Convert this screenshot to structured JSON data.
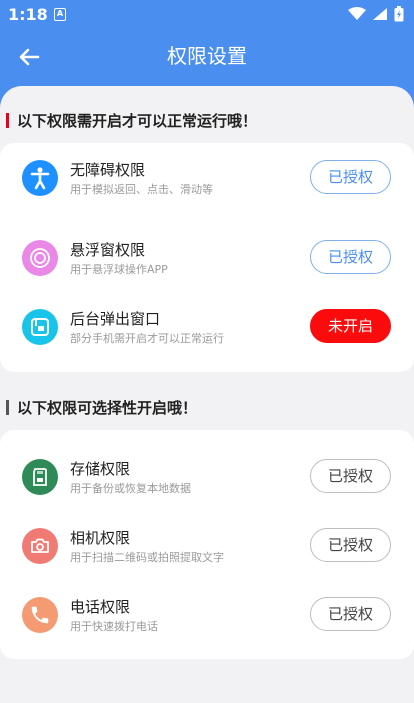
{
  "status_bar": {
    "time": "1:18",
    "sim_label": "A"
  },
  "header": {
    "title": "权限设置"
  },
  "sections": [
    {
      "title": "以下权限需开启才可以正常运行哦！",
      "bar_color": "#e8001c",
      "items": [
        {
          "name": "无障碍权限",
          "desc": "用于模拟返回、点击、滑动等",
          "button": "已授权",
          "icon": "accessibility-icon",
          "icon_color": "#1e90ff"
        },
        {
          "name": "悬浮窗权限",
          "desc": "用于悬浮球操作APP",
          "button": "已授权",
          "icon": "floating-window-icon",
          "icon_color": "#e988e6"
        },
        {
          "name": "后台弹出窗口",
          "desc": "部分手机需开启才可以正常运行",
          "button": "未开启",
          "icon": "popup-window-icon",
          "icon_color": "#18c4ea"
        }
      ]
    },
    {
      "title": "以下权限可选择性开启哦！",
      "bar_color": "#555555",
      "items": [
        {
          "name": "存储权限",
          "desc": "用于备份或恢复本地数据",
          "button": "已授权",
          "icon": "storage-sdcard-icon",
          "icon_color": "#2e8b57"
        },
        {
          "name": "相机权限",
          "desc": "用于扫描二维码或拍照提取文字",
          "button": "已授权",
          "icon": "camera-icon",
          "icon_color": "#f07b74"
        },
        {
          "name": "电话权限",
          "desc": "用于快速拨打电话",
          "button": "已授权",
          "icon": "phone-icon",
          "icon_color": "#f59b73"
        }
      ]
    }
  ],
  "colors": {
    "header_blue": "#4a8ff0",
    "granted_blue": "#4a8ff0",
    "not_enabled_red": "#fb0b0b",
    "background": "#f2f2f4"
  }
}
